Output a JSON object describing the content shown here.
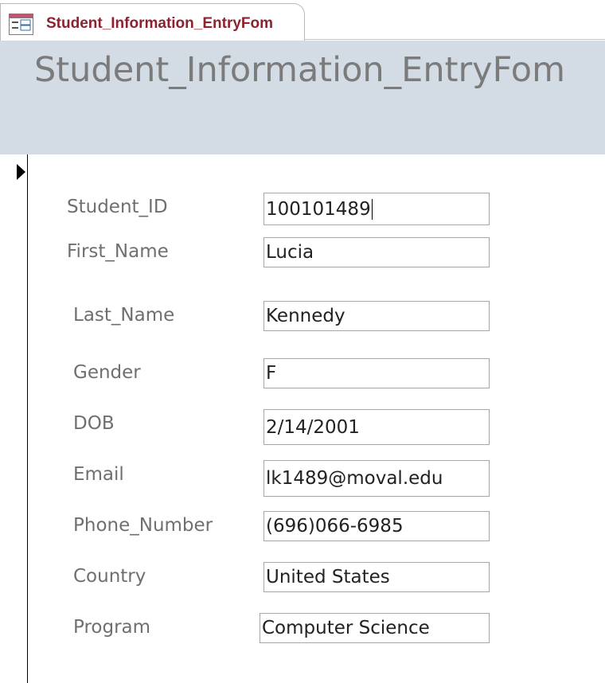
{
  "tab": {
    "label": "Student_Information_EntryFom",
    "icon": "form-icon"
  },
  "form": {
    "title": "Student_Information_EntryFom"
  },
  "fields": {
    "student_id": {
      "label": "Student_ID",
      "value": "100101489"
    },
    "first_name": {
      "label": "First_Name",
      "value": "Lucia"
    },
    "last_name": {
      "label": "Last_Name",
      "value": "Kennedy"
    },
    "gender": {
      "label": "Gender",
      "value": "F"
    },
    "dob": {
      "label": "DOB",
      "value": "2/14/2001"
    },
    "email": {
      "label": "Email",
      "value": "lk1489@moval.edu"
    },
    "phone_number": {
      "label": "Phone_Number",
      "value": "(696)066-6985"
    },
    "country": {
      "label": "Country",
      "value": "United States"
    },
    "program": {
      "label": "Program",
      "value": "Computer Science"
    }
  },
  "colors": {
    "tab_text": "#8b2330",
    "header_bg": "#d3dbe5",
    "title_text": "#7b7b7b",
    "label_text": "#6f6f6f"
  }
}
